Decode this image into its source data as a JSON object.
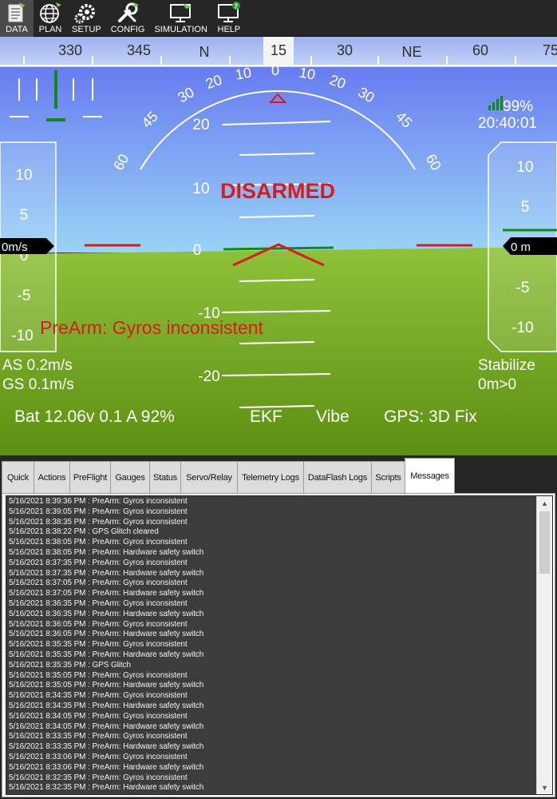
{
  "toolbar": {
    "items": [
      {
        "label": "DATA",
        "icon": "data-icon",
        "active": true
      },
      {
        "label": "PLAN",
        "icon": "globe-icon",
        "active": false
      },
      {
        "label": "SETUP",
        "icon": "gears-icon",
        "active": false
      },
      {
        "label": "CONFIG",
        "icon": "wrench-icon",
        "active": false
      },
      {
        "label": "SIMULATION",
        "icon": "monitor-plane-icon",
        "active": false
      },
      {
        "label": "HELP",
        "icon": "monitor-question-icon",
        "active": false
      }
    ]
  },
  "hud": {
    "heading_labels": [
      "330",
      "345",
      "N",
      "15",
      "30",
      "NE",
      "60",
      "75"
    ],
    "heading_current": "15",
    "roll_labels": [
      "60",
      "45",
      "30",
      "20",
      "10",
      "0",
      "10",
      "20",
      "30",
      "45",
      "60"
    ],
    "pitch_labels": [
      "20",
      "10",
      "0",
      "-10",
      "-20"
    ],
    "airspeed_scale": [
      "10",
      "5",
      "0",
      "-5",
      "-10"
    ],
    "airspeed_value": "0m/s",
    "altitude_scale": [
      "10",
      "5",
      "0",
      "-5",
      "-10"
    ],
    "altitude_value": "0 m",
    "battery_signal": "99%",
    "clock": "20:40:01",
    "armed_status": "DISARMED",
    "prearm_message": "PreArm: Gyros inconsistent",
    "airspeed_text": "AS 0.2m/s",
    "groundspeed_text": "GS 0.1m/s",
    "flight_mode": "Stabilize",
    "distance_text": "0m>0",
    "battery_text": "Bat 12.06v 0.1 A 92%",
    "ekf_label": "EKF",
    "vibe_label": "Vibe",
    "gps_text": "GPS: 3D Fix",
    "colors": {
      "sky_top": "#5f6ef0",
      "sky_bottom": "#9ad3f5",
      "ground_top": "#8fc23a",
      "ground_bottom": "#5c8e12",
      "alert": "#d81c1c",
      "ok": "#118a11"
    }
  },
  "tabs": [
    {
      "label": "Quick",
      "active": false
    },
    {
      "label": "Actions",
      "active": false
    },
    {
      "label": "PreFlight",
      "active": false
    },
    {
      "label": "Gauges",
      "active": false
    },
    {
      "label": "Status",
      "active": false
    },
    {
      "label": "Servo/Relay",
      "active": false
    },
    {
      "label": "Telemetry Logs",
      "active": false
    },
    {
      "label": "DataFlash Logs",
      "active": false
    },
    {
      "label": "Scripts",
      "active": false
    },
    {
      "label": "Messages",
      "active": true
    }
  ],
  "messages": [
    "5/16/2021 8:39:36 PM : PreArm: Gyros inconsistent",
    "5/16/2021 8:39:05 PM : PreArm: Gyros inconsistent",
    "5/16/2021 8:38:35 PM : PreArm: Gyros inconsistent",
    "5/16/2021 8:38:22 PM : GPS Glitch cleared",
    "5/16/2021 8:38:05 PM : PreArm: Gyros inconsistent",
    "5/16/2021 8:38:05 PM : PreArm: Hardware safety switch",
    "5/16/2021 8:37:35 PM : PreArm: Gyros inconsistent",
    "5/16/2021 8:37:35 PM : PreArm: Hardware safety switch",
    "5/16/2021 8:37:05 PM : PreArm: Gyros inconsistent",
    "5/16/2021 8:37:05 PM : PreArm: Hardware safety switch",
    "5/16/2021 8:36:35 PM : PreArm: Gyros inconsistent",
    "5/16/2021 8:36:35 PM : PreArm: Hardware safety switch",
    "5/16/2021 8:36:05 PM : PreArm: Gyros inconsistent",
    "5/16/2021 8:36:05 PM : PreArm: Hardware safety switch",
    "5/16/2021 8:35:35 PM : PreArm: Gyros inconsistent",
    "5/16/2021 8:35:35 PM : PreArm: Hardware safety switch",
    "5/16/2021 8:35:35 PM : GPS Glitch",
    "5/16/2021 8:35:05 PM : PreArm: Gyros inconsistent",
    "5/16/2021 8:35:05 PM : PreArm: Hardware safety switch",
    "5/16/2021 8:34:35 PM : PreArm: Gyros inconsistent",
    "5/16/2021 8:34:35 PM : PreArm: Hardware safety switch",
    "5/16/2021 8:34:05 PM : PreArm: Gyros inconsistent",
    "5/16/2021 8:34:05 PM : PreArm: Hardware safety switch",
    "5/16/2021 8:33:35 PM : PreArm: Gyros inconsistent",
    "5/16/2021 8:33:35 PM : PreArm: Hardware safety switch",
    "5/16/2021 8:33:06 PM : PreArm: Gyros inconsistent",
    "5/16/2021 8:33:06 PM : PreArm: Hardware safety switch",
    "5/16/2021 8:32:35 PM : PreArm: Gyros inconsistent",
    "5/16/2021 8:32:35 PM : PreArm: Hardware safety switch"
  ]
}
